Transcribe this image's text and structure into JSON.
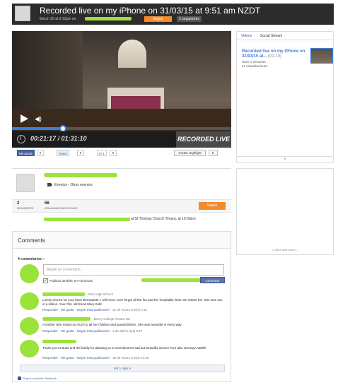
{
  "header": {
    "title": "Recorded live on my iPhone on 31/03/15 at 9:51 am NZDT",
    "subtitle": "March 30 at 6:12pm en",
    "follow_label": "Seguir",
    "followers_label": "2 seguidores"
  },
  "player": {
    "time": "00:21:17 / 01:31:10",
    "badge": "RECORDED LIVE",
    "progress": 0.233
  },
  "social": {
    "like_label": "Me gusta",
    "like_count": "0",
    "tweet_label": "Tweet",
    "tweet_count": "0",
    "gplus_label": "8+1",
    "gplus_count": "0",
    "highlight_label": "Create Highlight",
    "share_label": "▸"
  },
  "info": {
    "category": "Eventos - Otros eventos",
    "followers_num": "2",
    "followers_lbl": "SEGUIDORES",
    "views_num": "56",
    "views_lbl": "VISUALIZACIONES EN VIVO",
    "follow_label": "Seguir",
    "location_text": "at St Thomas Church Timaru, at 10:30am"
  },
  "comments": {
    "title": "Comments",
    "count_label": "4 comentarios",
    "sort_label": "»",
    "placeholder": "Añade un comentario...",
    "fb_check": "✓",
    "fb_label": "Publicar también en Facebook",
    "submit_label": "Comentar",
    "items": [
      {
        "org": "- Soro High School",
        "text": "Lovely service for your Mum Bernadette. I will never, ever forget all the fun and her hospitality when we visited her. She was one in a million. Your Old, old friend Mary Kidd",
        "reply": "Responder",
        "like": "Me gusta",
        "follow": "Seguir esta publicación",
        "date": "31 de marzo a la(s) 5:34"
      },
      {
        "org": "- Mercy College Timaru NZ",
        "text": "A mother who meant so much to all her children and grandchildren. She was beautiful in every way",
        "reply": "Responder",
        "like": "Me gusta",
        "follow": "Seguir esta publicación",
        "date": "1 de abril a la(s) 3:27"
      },
      {
        "org": "",
        "text": "Thank you to Butts and the family for allowing us to view Bloom's sad but beautiful service from afar. Bronwyn Walsh",
        "reply": "Responder",
        "like": "Me gusta",
        "follow": "Seguir esta publicación",
        "date": "30 de marzo a la(s) 21:38"
      }
    ],
    "more_label": "Ver 1 más ∨",
    "plugin_label": "Plug-in social de Facebook"
  },
  "sidebar": {
    "tab_videos": "Videos",
    "tab_social": "Social Stream",
    "video_title": "Recorded live on my iPhone on 31/03/15 at...",
    "video_duration": "(01:10)",
    "video_age": "Hace 1 semanas",
    "video_views": "42 visualizaciones",
    "scroll_label": "⇕",
    "ad_question": "¿Sobre este aviso? ¡"
  }
}
